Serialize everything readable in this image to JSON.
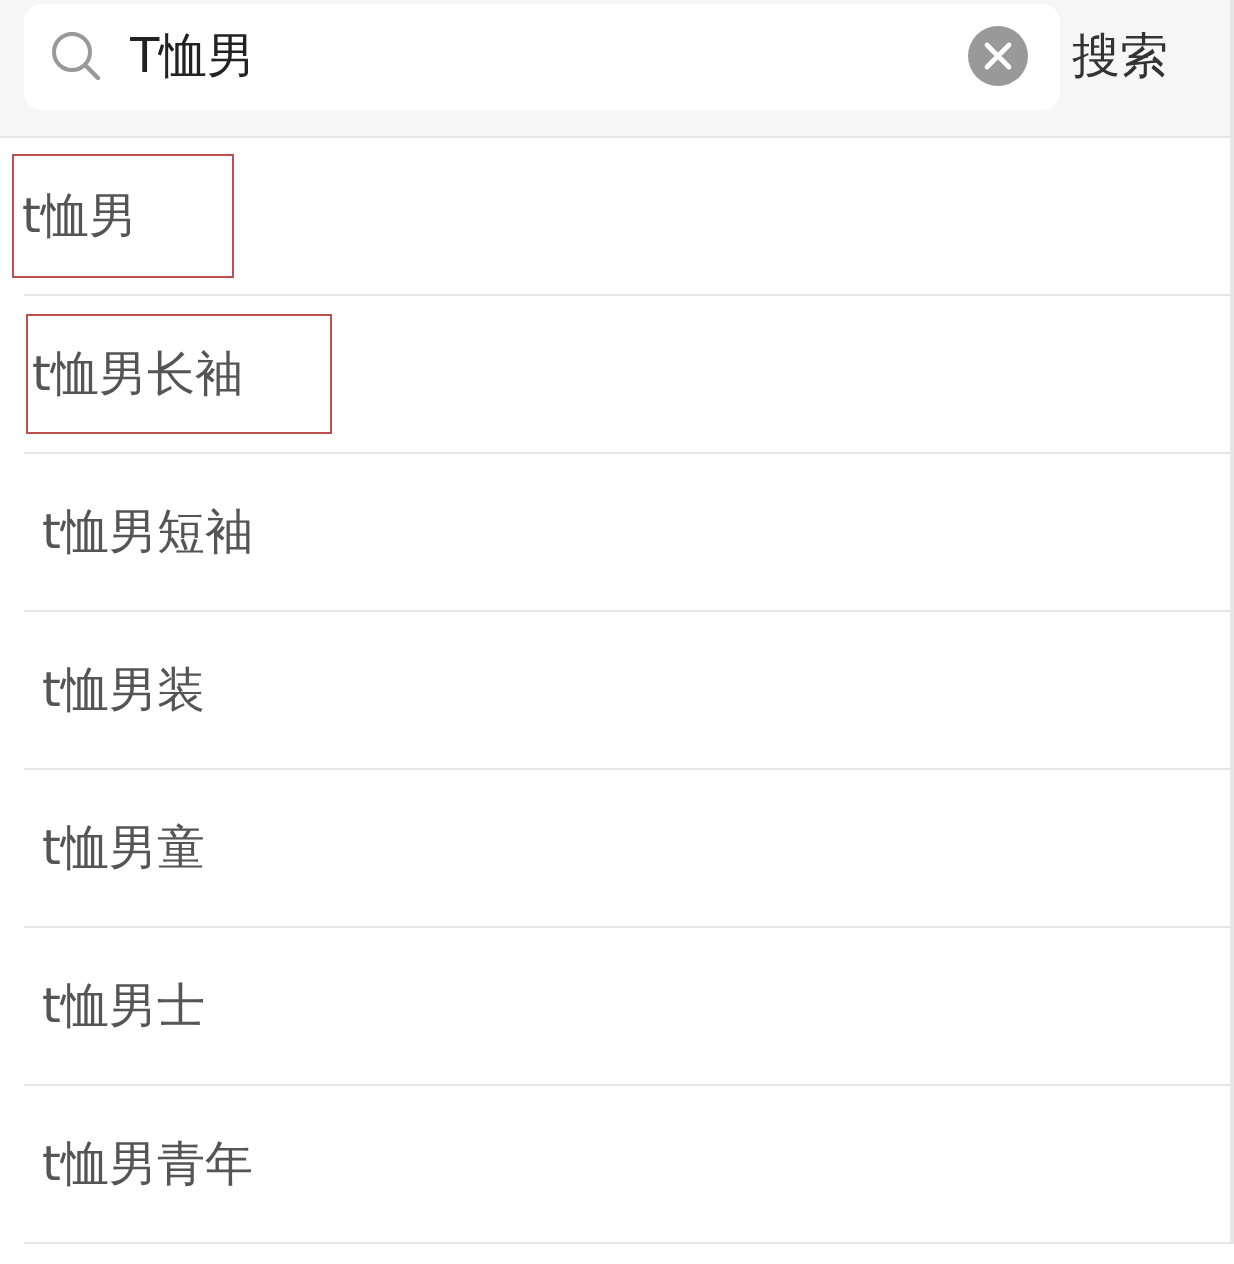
{
  "search": {
    "value": "T恤男",
    "button": "搜索"
  },
  "suggestions": [
    {
      "text": "t恤男",
      "marked": true
    },
    {
      "text": "t恤男长袖",
      "marked": true
    },
    {
      "text": "t恤男短袖",
      "marked": false
    },
    {
      "text": "t恤男装",
      "marked": false
    },
    {
      "text": "t恤男童",
      "marked": false
    },
    {
      "text": "t恤男士",
      "marked": false
    },
    {
      "text": "t恤男青年",
      "marked": false
    }
  ]
}
